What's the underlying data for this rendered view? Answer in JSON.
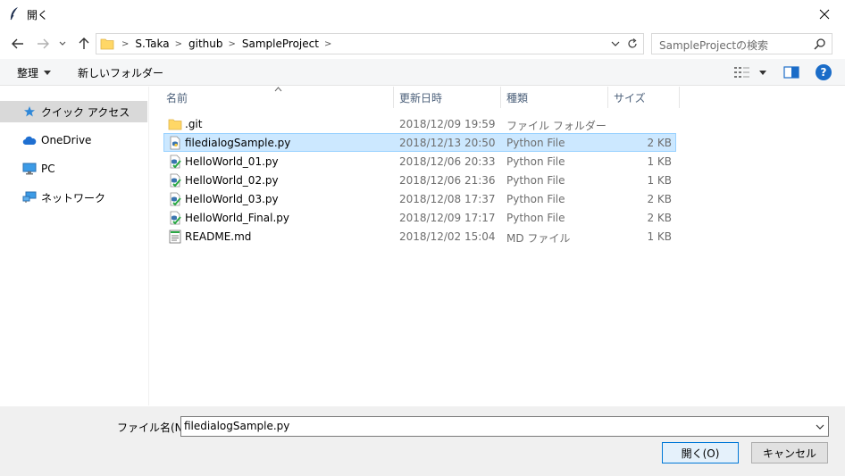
{
  "window": {
    "title": "開く",
    "icon": "feather-icon",
    "close_icon": "close-icon"
  },
  "nav": {
    "back_icon": "arrow-left-icon",
    "forward_icon": "arrow-right-icon",
    "recent_icon": "chevron-down-icon",
    "up_icon": "arrow-up-icon"
  },
  "address": {
    "crumbs": [
      "S.Taka",
      "github",
      "SampleProject"
    ],
    "separator": ">"
  },
  "search": {
    "placeholder": "SampleProjectの検索"
  },
  "toolbar": {
    "organize_label": "整理",
    "new_folder_label": "新しいフォルダー"
  },
  "sidebar": {
    "items": [
      {
        "label": "クイック アクセス",
        "icon": "star-icon",
        "selected": true
      },
      {
        "label": "OneDrive",
        "icon": "cloud-icon",
        "selected": false
      },
      {
        "label": "PC",
        "icon": "monitor-icon",
        "selected": false
      },
      {
        "label": "ネットワーク",
        "icon": "network-icon",
        "selected": false
      }
    ]
  },
  "columns": {
    "name": "名前",
    "date": "更新日時",
    "type": "種類",
    "size": "サイズ"
  },
  "files": [
    {
      "name": ".git",
      "date": "2018/12/09 19:59",
      "type": "ファイル フォルダー",
      "size": "",
      "icon": "folder-icon",
      "selected": false
    },
    {
      "name": "filedialogSample.py",
      "date": "2018/12/13 20:50",
      "type": "Python File",
      "size": "2 KB",
      "icon": "python-file-icon",
      "selected": true
    },
    {
      "name": "HelloWorld_01.py",
      "date": "2018/12/06 20:33",
      "type": "Python File",
      "size": "1 KB",
      "icon": "python-file-icon",
      "selected": false
    },
    {
      "name": "HelloWorld_02.py",
      "date": "2018/12/06 21:36",
      "type": "Python File",
      "size": "1 KB",
      "icon": "python-file-icon",
      "selected": false
    },
    {
      "name": "HelloWorld_03.py",
      "date": "2018/12/08 17:37",
      "type": "Python File",
      "size": "2 KB",
      "icon": "python-file-icon",
      "selected": false
    },
    {
      "name": "HelloWorld_Final.py",
      "date": "2018/12/09 17:17",
      "type": "Python File",
      "size": "2 KB",
      "icon": "python-file-icon",
      "selected": false
    },
    {
      "name": "README.md",
      "date": "2018/12/02 15:04",
      "type": "MD ファイル",
      "size": "1 KB",
      "icon": "markdown-file-icon",
      "selected": false
    }
  ],
  "footer": {
    "filename_label": "ファイル名(N):",
    "filename_value": "filedialogSample.py",
    "open_label": "開く(O)",
    "cancel_label": "キャンセル"
  },
  "colors": {
    "selection_bg": "#cce8ff",
    "selection_border": "#99d1ff",
    "accent": "#0078d7",
    "folder": "#ffd766"
  }
}
